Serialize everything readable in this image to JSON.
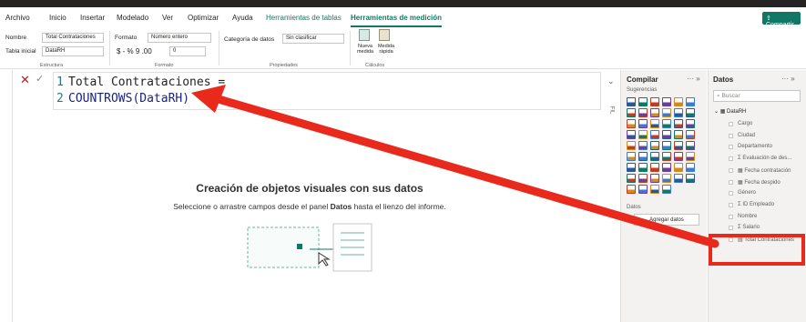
{
  "ribbon_tabs": [
    "Archivo",
    "Inicio",
    "Insertar",
    "Modelado",
    "Ver",
    "Optimizar",
    "Ayuda",
    "Herramientas de tablas",
    "Herramientas de medición"
  ],
  "share_label": "Compartir",
  "ribbon": {
    "name_label": "Nombre",
    "name_value": "Total Contrataciones",
    "home_table_label": "Tabla inicial",
    "home_table_value": "DataRH",
    "format_label": "Formato",
    "format_value": "Número entero",
    "format_symbols": "$ - % 9 .00",
    "decimals_value": "0",
    "category_label": "Categoría de datos",
    "category_value": "Sin clasificar",
    "new_measure": "Nueva medida",
    "quick_measure": "Medida rápida",
    "groups": [
      "Estructura",
      "Formato",
      "Propiedades",
      "Cálculos"
    ]
  },
  "formula": {
    "line1_no": "1",
    "line1": "Total Contrataciones =",
    "line2_no": "2",
    "line2": "COUNTROWS(DataRH)"
  },
  "empty_state": {
    "title": "Creación de objetos visuales con sus datos",
    "subtitle_pre": "Seleccione o arrastre campos desde el panel ",
    "subtitle_bold": "Datos",
    "subtitle_post": " hasta el lienzo del informe."
  },
  "compile": {
    "title": "Compilar",
    "subtitle": "Sugerencias",
    "datos_label": "Datos",
    "add_data": "Agregar datos"
  },
  "datos": {
    "title": "Datos",
    "search_placeholder": "Buscar",
    "table": "DataRH",
    "fields": [
      "Cargo",
      "Ciudad",
      "Departamento",
      "Evaluación de des...",
      "Fecha contratación",
      "Fecha despido",
      "Género",
      "ID Empleado",
      "Nombre",
      "Salario",
      "Total Contrataciones"
    ]
  },
  "colors": {
    "accent": "#117865",
    "arrow": "#e8291c"
  }
}
